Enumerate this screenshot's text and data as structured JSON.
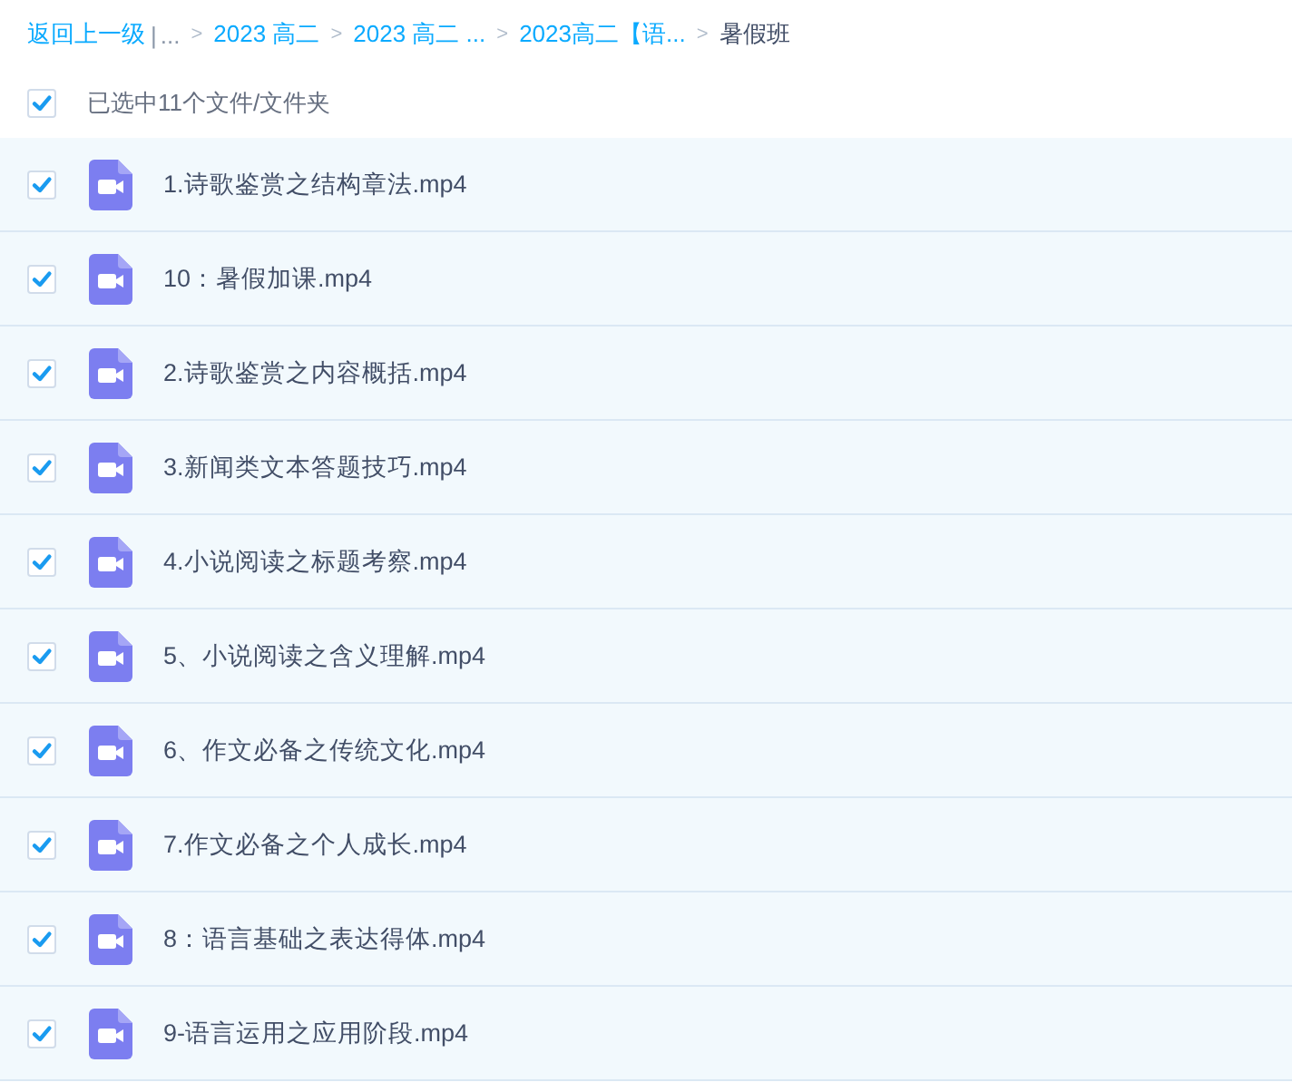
{
  "breadcrumb": [
    {
      "kind": "link",
      "label": "返回上一级"
    },
    {
      "kind": "divider",
      "label": "|"
    },
    {
      "kind": "ellipsis",
      "label": "..."
    },
    {
      "kind": "separator",
      "label": ">"
    },
    {
      "kind": "link",
      "label": "2023 高二"
    },
    {
      "kind": "separator",
      "label": ">"
    },
    {
      "kind": "link",
      "label": "2023 高二 ..."
    },
    {
      "kind": "separator",
      "label": ">"
    },
    {
      "kind": "link",
      "label": "2023高二【语..."
    },
    {
      "kind": "separator",
      "label": ">"
    },
    {
      "kind": "current",
      "label": "暑假班"
    }
  ],
  "selection": {
    "checked": true,
    "label": "已选中11个文件/文件夹"
  },
  "files": [
    {
      "name": "1.诗歌鉴赏之结构章法.mp4",
      "checked": true
    },
    {
      "name": "10：暑假加课.mp4",
      "checked": true
    },
    {
      "name": "2.诗歌鉴赏之内容概括.mp4",
      "checked": true
    },
    {
      "name": "3.新闻类文本答题技巧.mp4",
      "checked": true
    },
    {
      "name": "4.小说阅读之标题考察.mp4",
      "checked": true
    },
    {
      "name": "5、小说阅读之含义理解.mp4",
      "checked": true
    },
    {
      "name": "6、作文必备之传统文化.mp4",
      "checked": true
    },
    {
      "name": "7.作文必备之个人成长.mp4",
      "checked": true
    },
    {
      "name": "8：语言基础之表达得体.mp4",
      "checked": true
    },
    {
      "name": "9-语言运用之应用阶段.mp4",
      "checked": true
    }
  ]
}
